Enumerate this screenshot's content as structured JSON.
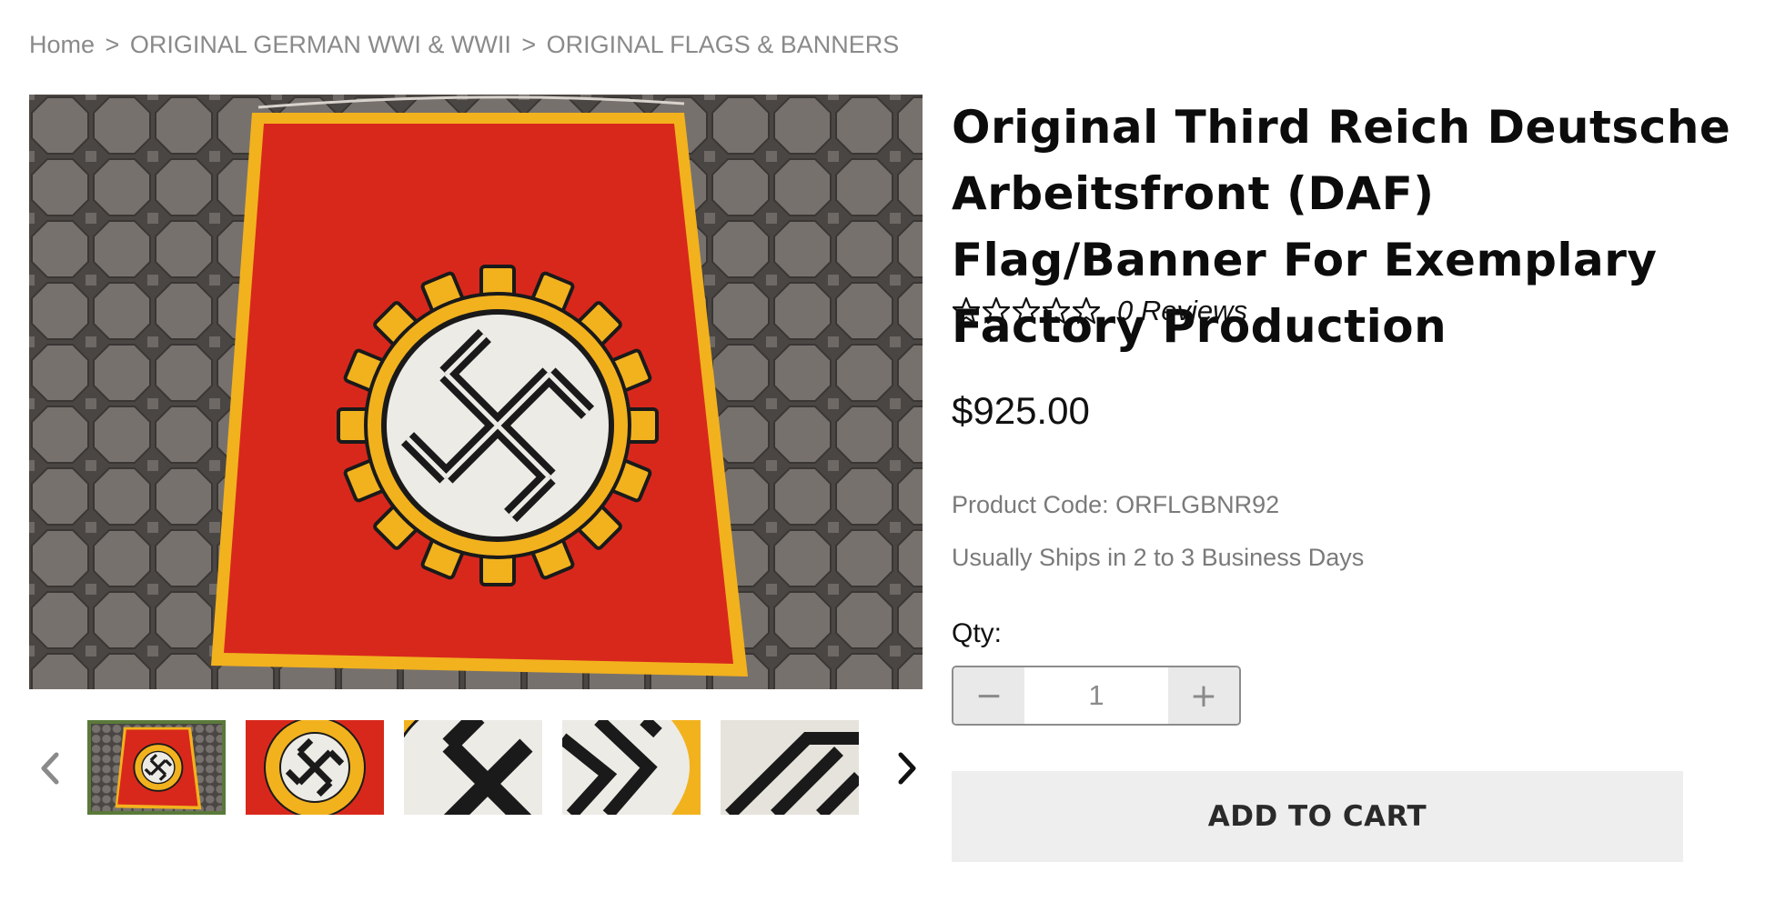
{
  "breadcrumb": {
    "home": "Home",
    "separator": ">",
    "level1": "ORIGINAL GERMAN WWI & WWII",
    "level2": "ORIGINAL FLAGS & BANNERS"
  },
  "product": {
    "title": "Original Third Reich Deutsche Arbeitsfront (DAF) Flag/Banner For Exemplary Factory Production",
    "rating_stars": 0,
    "rating_max": 5,
    "reviews_text": "0 Reviews",
    "price": "$925.00",
    "product_code": "Product Code: ORFLGBNR92",
    "shipping": "Usually Ships in 2 to 3 Business Days"
  },
  "quantity": {
    "label": "Qty:",
    "value": "1",
    "decrement": "−",
    "increment": "+"
  },
  "cart": {
    "add_label": "ADD TO CART"
  },
  "gallery": {
    "thumbnail_count": 5,
    "selected_index": 0,
    "prev_icon": "chevron-left-icon",
    "next_icon": "chevron-right-icon"
  },
  "colors": {
    "banner_red": "#d8281c",
    "border_gold": "#f2b21e",
    "selected_thumb_border": "#5a7a3a",
    "button_bg": "#eeeeee"
  }
}
